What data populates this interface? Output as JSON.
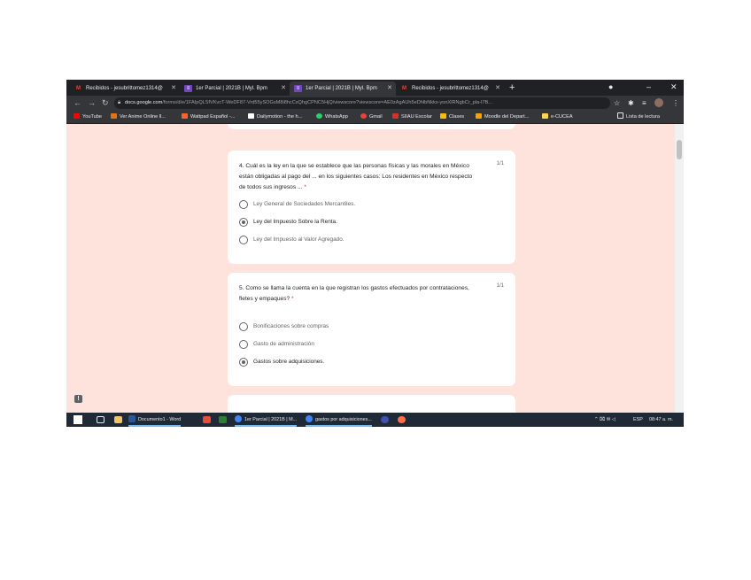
{
  "browser": {
    "tabs": [
      {
        "label": "Recibidos - jesubrittomez1314@",
        "icon": "gmail-icon",
        "icon_color": "#ea4335",
        "active": false
      },
      {
        "label": "1er Parcial | 2021B | Myl. Bpm",
        "icon": "google-forms-icon",
        "icon_color": "#7248b9",
        "active": false
      },
      {
        "label": "1er Parcial | 2021B | Myl. Bpm",
        "icon": "google-forms-icon",
        "icon_color": "#7248b9",
        "active": true
      },
      {
        "label": "Recibidos - jesubrittomez1314@",
        "icon": "gmail-icon",
        "icon_color": "#ea4335",
        "active": false
      }
    ],
    "url_host": "docs.google.com",
    "url_rest": "/forms/d/e/1FAIpQLSfVKvcT-WeDF87-Vrd55ySOGsM8i8hcCsQhgCPNC5HjQ/viewscore?viewscore=AE0zAgAUh5eDhlbNkkx-yonXlRNgbCr_pla-l7B..."
  },
  "bookmarks": [
    {
      "label": "YouTube",
      "color": "#ff0000"
    },
    {
      "label": "Ver Anime Online ll...",
      "color": "#e8710a"
    },
    {
      "label": "Wattpad Español -...",
      "color": "#ff6122"
    },
    {
      "label": "Dailymotion - the h...",
      "color": "#ffffff"
    },
    {
      "label": "WhatsApp",
      "color": "#25d366"
    },
    {
      "label": "Gmail",
      "color": "#ea4335"
    },
    {
      "label": "SIIAU Escolar",
      "color": "#d93025"
    },
    {
      "label": "Clases",
      "color": "#fbbc04"
    },
    {
      "label": "Moodle del Depart...",
      "color": "#f4a300"
    },
    {
      "label": "e-CUCEA",
      "color": "#ffd54f"
    }
  ],
  "reading_list": "Lista de lectura",
  "questions": [
    {
      "text": "4. Cuál es la ley en la que se establece que las personas físicas y las morales en México están obligadas al pago del ... en los siguientes casos: Los residentes en México respecto de todos sus ingresos ...",
      "required": "*",
      "points": "1/1",
      "options": [
        {
          "label": "Ley General de Sociedades Mercantiles.",
          "selected": false
        },
        {
          "label": "Ley del Impuesto Sobre la Renta.",
          "selected": true
        },
        {
          "label": "Ley del Impuesto al Valor Agregado.",
          "selected": false
        }
      ]
    },
    {
      "text": "5. Como se llama la cuenta en la que registran los gastos efectuados por contrataciones, fletes y empaques?",
      "required": "*",
      "points": "1/1",
      "options": [
        {
          "label": "Bonificaciones sobre compras",
          "selected": false
        },
        {
          "label": "Gasto de administración",
          "selected": false
        },
        {
          "label": "Gastos sobre adquisiciones.",
          "selected": true
        }
      ]
    }
  ],
  "taskbar": {
    "items": [
      {
        "label": "Documento1 - Word",
        "color": "#2b579a"
      },
      {
        "label": "1er Parcial | 2021B | M...",
        "color": "#4285f4"
      },
      {
        "label": "gastos por adquisiciones...",
        "color": "#4285f4"
      }
    ],
    "lang": "ESP",
    "time": "08:47 a. m."
  }
}
